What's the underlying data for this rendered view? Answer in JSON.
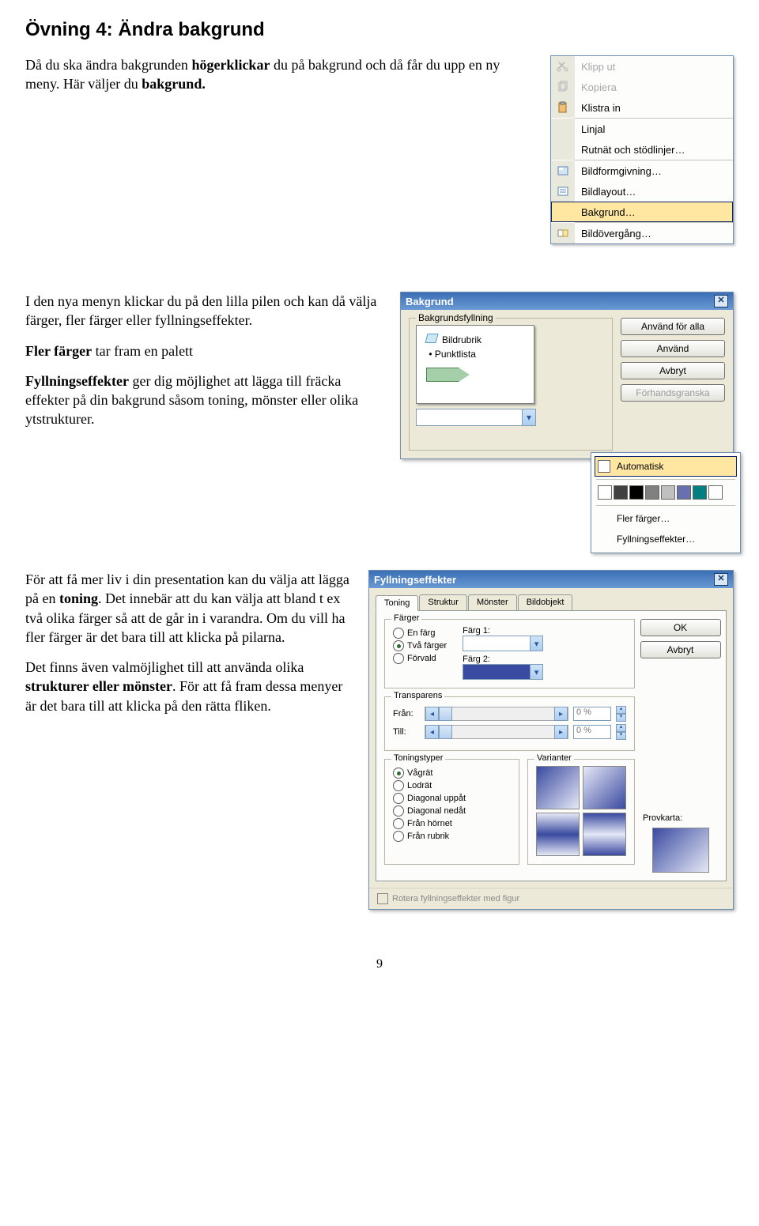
{
  "title": "Övning 4: Ändra bakgrund",
  "intro_pre": "Då du ska ändra bakgrunden ",
  "intro_bold1": "högerklickar",
  "intro_mid": " du på bakgrund och då får du upp en ny meny. Här väljer du ",
  "intro_bold2": "bakgrund.",
  "p2_a": "I den nya menyn klickar du på den lilla pilen och kan då välja färger, fler färger eller fyllningseffekter.",
  "p2_b_bold": "Fler färger",
  "p2_b_rest": " tar fram en palett",
  "p2_c_bold": "Fyllningseffekter",
  "p2_c_rest": " ger dig möjlighet att lägga till fräcka effekter på din bakgrund såsom toning, mönster eller olika ytstrukturer.",
  "p3_a_pre": "För att få mer liv i din presentation kan du välja att lägga på en ",
  "p3_a_bold": "toning",
  "p3_a_post": ". Det innebär att du kan välja att bland t ex två olika färger så att de går in i varandra. Om du vill ha fler färger är det bara till att klicka på pilarna.",
  "p3_b_pre": "Det finns även valmöjlighet till att använda olika ",
  "p3_b_bold": "strukturer eller mönster",
  "p3_b_post": ". För att få fram dessa menyer är det bara till att klicka på den rätta fliken.",
  "page_number": "9",
  "ctx_menu": {
    "klipp": "Klipp ut",
    "kopiera": "Kopiera",
    "klistra": "Klistra in",
    "linjal": "Linjal",
    "rutn": "Rutnät och stödlinjer…",
    "bildform": "Bildformgivning…",
    "bildlayout": "Bildlayout…",
    "bakgrund": "Bakgrund…",
    "bildov": "Bildövergång…"
  },
  "bakgrund_dlg": {
    "title": "Bakgrund",
    "legend": "Bakgrundsfyllning",
    "preview_title": "Bildrubrik",
    "preview_bullet": "Punktlista",
    "btn_all": "Använd för alla",
    "btn_apply": "Använd",
    "btn_cancel": "Avbryt",
    "btn_preview": "Förhandsgranska"
  },
  "colorpicker": {
    "auto": "Automatisk",
    "more": "Fler färger…",
    "fill": "Fyllningseffekter…",
    "swatches": [
      "#ffffff",
      "#404040",
      "#000000",
      "#808080",
      "#c0c0c0",
      "#6a6fb0",
      "#008080",
      "#ffffff"
    ]
  },
  "fx": {
    "title": "Fyllningseffekter",
    "tabs": [
      "Toning",
      "Struktur",
      "Mönster",
      "Bildobjekt"
    ],
    "grp_colors": "Färger",
    "r_one": "En färg",
    "r_two": "Två färger",
    "r_pre": "Förvald",
    "lbl_c1": "Färg 1:",
    "lbl_c2": "Färg 2:",
    "grp_trans": "Transparens",
    "lbl_from": "Från:",
    "lbl_to": "Till:",
    "pct": "0 %",
    "grp_types": "Toningstyper",
    "grp_variants": "Varianter",
    "r_vag": "Vågrät",
    "r_lod": "Lodrät",
    "r_diagup": "Diagonal uppåt",
    "r_diagdn": "Diagonal nedåt",
    "r_horn": "Från hörnet",
    "r_rubr": "Från rubrik",
    "btn_ok": "OK",
    "btn_cancel": "Avbryt",
    "lbl_sample": "Provkarta:",
    "footer": "Rotera fyllningseffekter med figur"
  }
}
